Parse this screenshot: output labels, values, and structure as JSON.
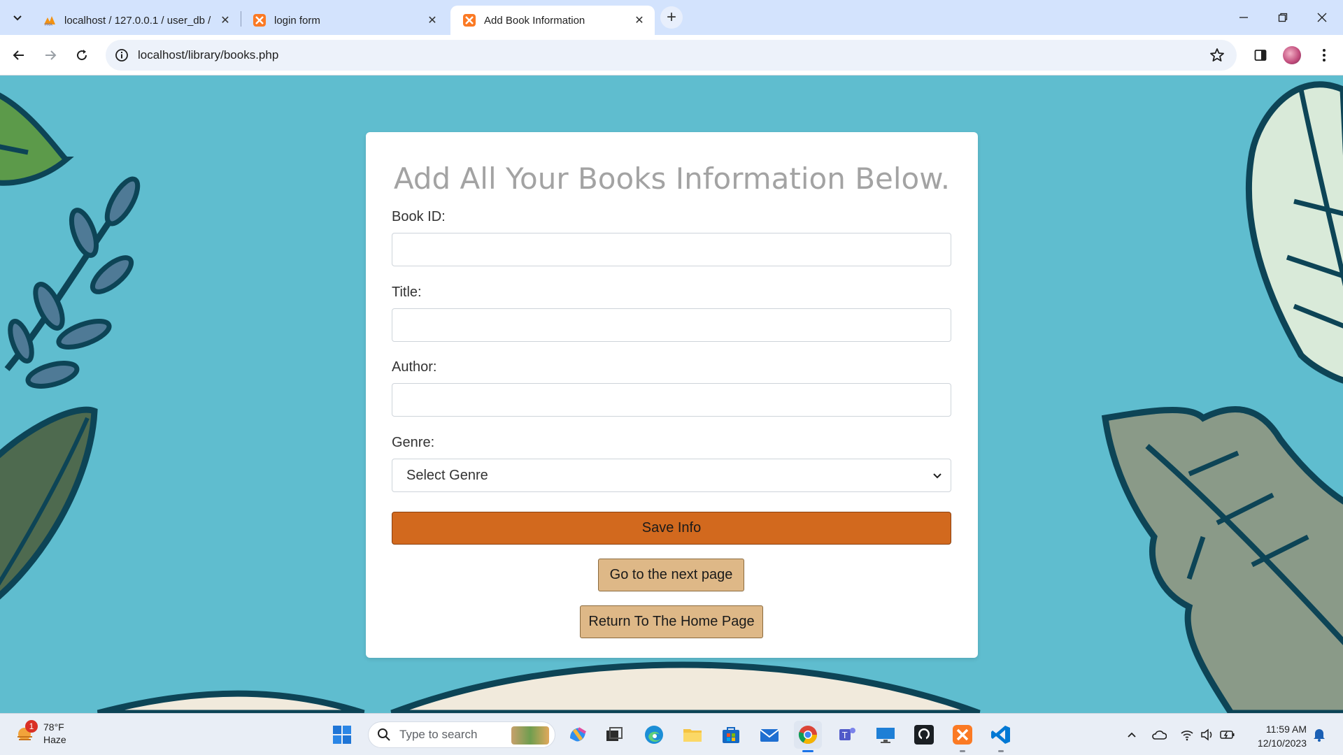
{
  "browser": {
    "tabs": [
      {
        "title": "localhost / 127.0.0.1 / user_db /",
        "active": false
      },
      {
        "title": "login form",
        "active": false
      },
      {
        "title": "Add Book Information",
        "active": true
      }
    ],
    "url": "localhost/library/books.php"
  },
  "page": {
    "heading": "Add All Your Books Information Below.",
    "fields": {
      "book_id": {
        "label": "Book ID:",
        "value": ""
      },
      "title": {
        "label": "Title:",
        "value": ""
      },
      "author": {
        "label": "Author:",
        "value": ""
      },
      "genre": {
        "label": "Genre:",
        "selected": "Select Genre"
      }
    },
    "buttons": {
      "save": "Save Info",
      "next": "Go to the next page",
      "home": "Return To The Home Page"
    },
    "colors": {
      "background": "#5fbdcf",
      "save_button": "#d2691e",
      "secondary_button": "#deb887",
      "heading": "#a3a3a3"
    }
  },
  "taskbar": {
    "weather": {
      "temp": "78°F",
      "condition": "Haze",
      "badge": "1"
    },
    "search_placeholder": "Type to search",
    "clock": {
      "time": "11:59 AM",
      "date": "12/10/2023"
    },
    "apps": [
      "windows-start",
      "copilot",
      "task-view",
      "edge",
      "file-explorer",
      "microsoft-store",
      "mail",
      "chrome",
      "teams",
      "remote-desktop",
      "github",
      "xampp",
      "vscode"
    ]
  }
}
